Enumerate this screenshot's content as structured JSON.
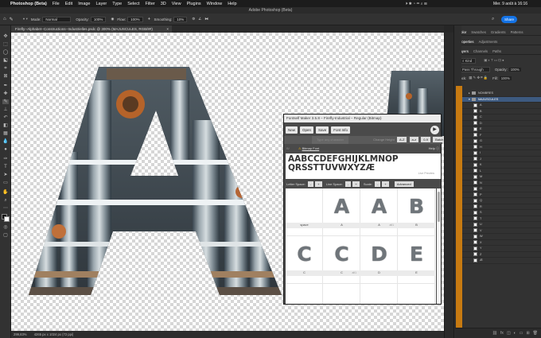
{
  "menubar": {
    "app": "Photoshop (Beta)",
    "items": [
      "File",
      "Edit",
      "Image",
      "Layer",
      "Type",
      "Select",
      "Filter",
      "3D",
      "View",
      "Plugins",
      "Window",
      "Help"
    ],
    "clock": "Mer. 9 août à 16:16"
  },
  "window_title": "Adobe Photoshop (Beta)",
  "options_bar": {
    "mode_label": "Mode:",
    "mode_value": "Normal",
    "opacity_label": "Opacity:",
    "opacity_value": "100%",
    "flow_label": "Flow:",
    "flow_value": "100%",
    "smoothing_label": "Smoothing:",
    "smoothing_value": "10%",
    "share_label": "Share"
  },
  "document_tab": "Firefly--Alphabet--Constructions--Industrielles.psdc @ 300% (MAJUSCULES, RGB/8#)",
  "status_bar": {
    "zoom": "299,83%",
    "dimensions": "4265 px x 1024 px (72 ppi)"
  },
  "panels": {
    "top_tabs": [
      "Color",
      "Swatches",
      "Gradients",
      "Patterns"
    ],
    "prop_tabs": [
      "Properties",
      "Adjustments"
    ],
    "layer_tabs": [
      "Layers",
      "Channels",
      "Paths"
    ],
    "filter_label": "Kind",
    "blend_mode": "Pass Through",
    "opacity_label": "Opacity:",
    "opacity_value": "100%",
    "lock_label": "Lock:",
    "fill_label": "Fill:",
    "fill_value": "100%",
    "groups": [
      {
        "name": "NOMBRES"
      },
      {
        "name": "MAJUSCULES"
      }
    ],
    "layers": [
      "A",
      "B",
      "C",
      "D",
      "E",
      "F",
      "G",
      "H",
      "I",
      "J",
      "K",
      "L",
      "M",
      "N",
      "O",
      "P",
      "Q",
      "R",
      "S",
      "T",
      "U",
      "V",
      "W",
      "X",
      "Y",
      "Z",
      "Æ"
    ]
  },
  "plugin": {
    "title": "Fontself Maker 3.5.8 – Firefly-Industrial – Regular (Bitmap)",
    "buttons": [
      "New",
      "Open",
      "Save",
      "Font Info"
    ],
    "next_glyph": "▶",
    "row2_left": "Type any character",
    "row2_label": "Change Height",
    "row2_buttons": [
      "A-Z",
      "a-z",
      "0-9",
      "Batch"
    ],
    "bitmap_label": "Bitmap Font",
    "help_label": "Help",
    "preview_line1": "AABCCDEFGHIJKLMNOP",
    "preview_line2": "QRSSTTUVWXYZÆ",
    "live_preview": "Live Preview",
    "letter_space_label": "Letter Space:",
    "line_space_label": "Line Space:",
    "scale_label": "Scale:",
    "advanced_label": "Advanced",
    "glyphs": [
      {
        "char": "",
        "name": "space",
        "uni": ""
      },
      {
        "char": "A",
        "name": "A",
        "uni": ""
      },
      {
        "char": "A",
        "name": "A",
        "uni": "alt1"
      },
      {
        "char": "B",
        "name": "B",
        "uni": ""
      },
      {
        "char": "C",
        "name": "C",
        "uni": ""
      },
      {
        "char": "C",
        "name": "C",
        "uni": "alt1"
      },
      {
        "char": "D",
        "name": "D",
        "uni": ""
      },
      {
        "char": "E",
        "name": "E",
        "uni": ""
      }
    ]
  },
  "colors": {
    "accent": "#1473e6",
    "layer_orange": "#c77a11",
    "panel_bg": "#323232"
  }
}
